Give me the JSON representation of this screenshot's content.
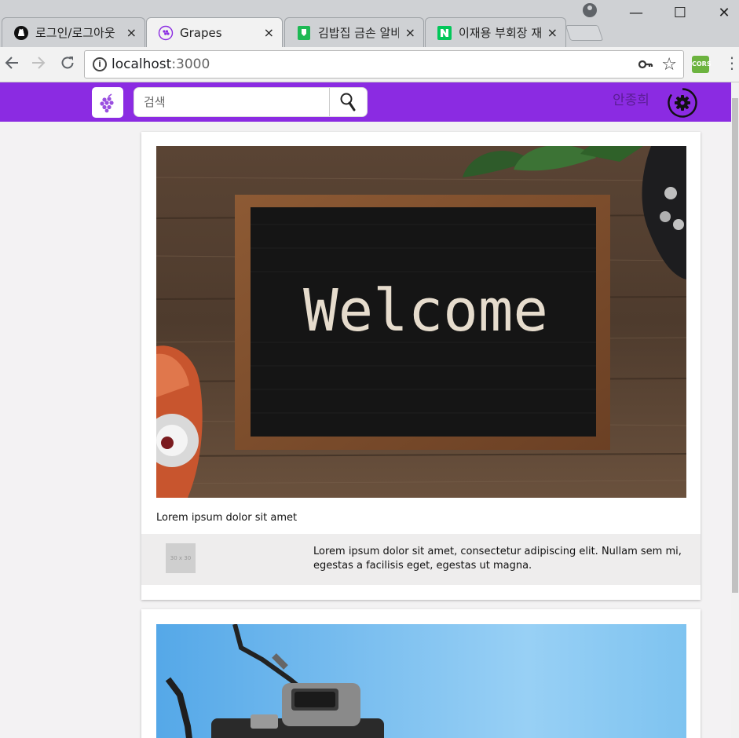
{
  "browser": {
    "tabs": [
      {
        "title": "로그인/로그아웃",
        "active": false
      },
      {
        "title": "Grapes",
        "active": true
      },
      {
        "title": "김밥집 금손 알바",
        "active": false
      },
      {
        "title": "이재용 부회장 재판",
        "active": false
      }
    ],
    "close_glyph": "×",
    "url_host": "localhost",
    "url_port": ":3000",
    "extension_label": "CORS",
    "win_min": "—",
    "win_max": "☐",
    "win_close": "✕"
  },
  "app": {
    "brand_color": "#8b2be2",
    "search_placeholder": "검색",
    "username": "안종희"
  },
  "posts": [
    {
      "image_text": "Welcome",
      "caption": "Lorem ipsum dolor sit amet",
      "comment": {
        "avatar_label": "30 x 30",
        "text": "Lorem ipsum dolor sit amet, consectetur adipiscing elit. Nullam sem mi, egestas a facilisis eget, egestas ut magna."
      }
    }
  ]
}
